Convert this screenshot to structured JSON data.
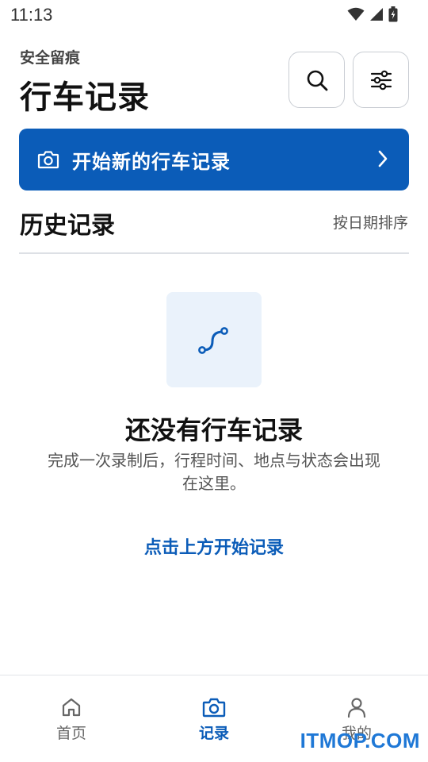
{
  "status_bar": {
    "time": "11:13"
  },
  "header": {
    "subtitle": "安全留痕",
    "title": "行车记录"
  },
  "start_button": {
    "label": "开始新的行车记录"
  },
  "history": {
    "title": "历史记录",
    "sort_label": "按日期排序"
  },
  "empty_state": {
    "title": "还没有行车记录",
    "description": "完成一次录制后，行程时间、地点与状态会出现在这里。",
    "cta": "点击上方开始记录"
  },
  "bottom_nav": {
    "items": [
      {
        "label": "首页",
        "icon": "home-icon",
        "active": false
      },
      {
        "label": "记录",
        "icon": "camera-icon",
        "active": true
      },
      {
        "label": "我的",
        "icon": "person-icon",
        "active": false
      }
    ]
  },
  "watermark": "ITMOP.COM",
  "colors": {
    "accent": "#0b5cb8",
    "illustration_bg": "#eaf2fb"
  }
}
